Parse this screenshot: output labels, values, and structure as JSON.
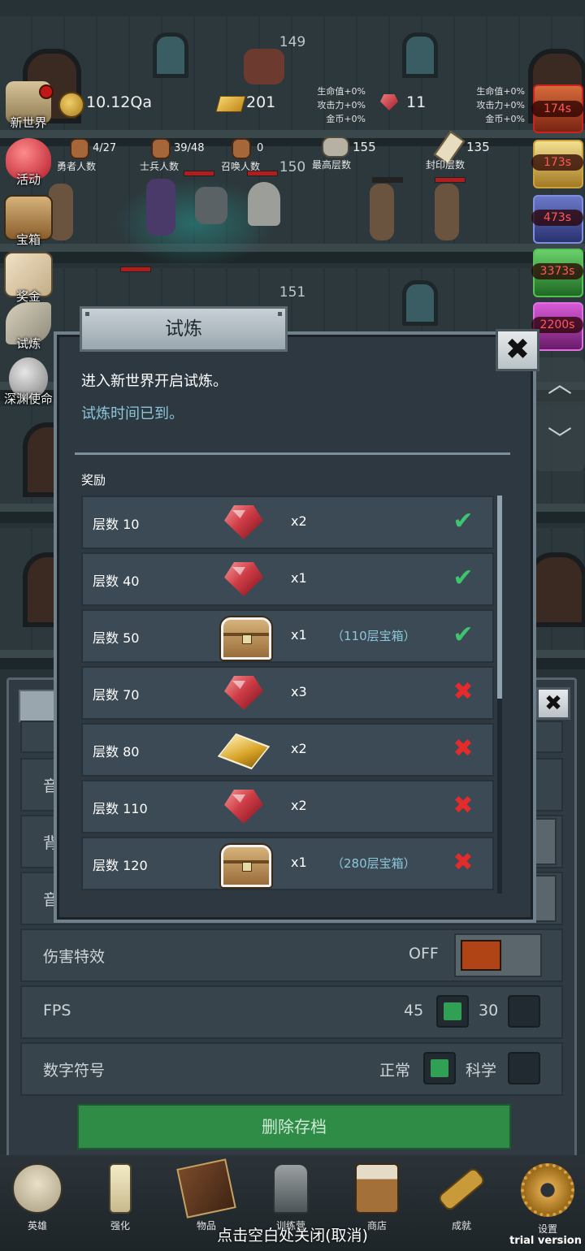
{
  "top_stats": {
    "floors": [
      "149",
      "150",
      "151"
    ],
    "gold": "10.12Qa",
    "gold_bars": "201",
    "gems": "11",
    "bonus_left": [
      "生命值+0%",
      "攻击力+0%",
      "金币+0%"
    ],
    "bonus_right": [
      "生命值+0%",
      "攻击力+0%",
      "金币+0%"
    ]
  },
  "counters": [
    {
      "value": "4/27",
      "label": "勇者人数"
    },
    {
      "value": "39/48",
      "label": "士兵人数"
    },
    {
      "value": "0",
      "label": "召唤人数"
    },
    {
      "value": "155",
      "label": "最高层数"
    },
    {
      "value": "135",
      "label": "封印层数"
    }
  ],
  "side_menu": [
    {
      "label": "新世界",
      "icon": "new-world-icon"
    },
    {
      "label": "活动",
      "icon": "heart-icon"
    },
    {
      "label": "宝箱",
      "icon": "chest-icon"
    },
    {
      "label": "奖金",
      "icon": "envelope-icon"
    },
    {
      "label": "试炼",
      "icon": "feather-icon"
    },
    {
      "label": "深渊使命",
      "icon": "orb-icon"
    }
  ],
  "timers": [
    "174s",
    "173s",
    "473s",
    "3373s",
    "2200s"
  ],
  "settings": {
    "rows": [
      {
        "label": "音"
      },
      {
        "label": "背"
      },
      {
        "label": "音"
      }
    ],
    "damage_effect": {
      "label": "伤害特效",
      "value": "OFF"
    },
    "fps": {
      "label": "FPS",
      "options": [
        "45",
        "30"
      ],
      "selected": "45"
    },
    "number_format": {
      "label": "数字符号",
      "options": [
        "正常",
        "科学"
      ],
      "selected": "正常"
    },
    "delete_save": "删除存档"
  },
  "dialog": {
    "title": "试炼",
    "close": "✖",
    "line1": "进入新世界开启试炼。",
    "line2": "试炼时间已到。",
    "rewards_title": "奖励",
    "rewards": [
      {
        "level": "层数 10",
        "item": "ruby",
        "qty": "x2",
        "note": "",
        "claimed": true
      },
      {
        "level": "层数 40",
        "item": "ruby",
        "qty": "x1",
        "note": "",
        "claimed": true
      },
      {
        "level": "层数 50",
        "item": "chest",
        "qty": "x1",
        "note": "（110层宝箱）",
        "claimed": true
      },
      {
        "level": "层数 70",
        "item": "ruby",
        "qty": "x3",
        "note": "",
        "claimed": false
      },
      {
        "level": "层数 80",
        "item": "gold-bar",
        "qty": "x2",
        "note": "",
        "claimed": false
      },
      {
        "level": "层数 110",
        "item": "ruby",
        "qty": "x2",
        "note": "",
        "claimed": false
      },
      {
        "level": "层数 120",
        "item": "chest",
        "qty": "x1",
        "note": "（280层宝箱）",
        "claimed": false
      }
    ]
  },
  "bottom_nav": [
    {
      "label": "英雄",
      "icon": "skull-icon"
    },
    {
      "label": "强化",
      "icon": "candle-icon"
    },
    {
      "label": "物品",
      "icon": "book-icon"
    },
    {
      "label": "训练营",
      "icon": "lantern-icon"
    },
    {
      "label": "商店",
      "icon": "mug-icon"
    },
    {
      "label": "成就",
      "icon": "key-icon"
    },
    {
      "label": "设置",
      "icon": "gear-icon"
    }
  ],
  "close_hint": "点击空白处关闭(取消)",
  "watermark": "trial version",
  "colors": {
    "claimed": "#3ec46d",
    "unclaimed": "#e42b2b",
    "accent_text": "#8cc7d9",
    "delete_button": "#2e8c47"
  }
}
